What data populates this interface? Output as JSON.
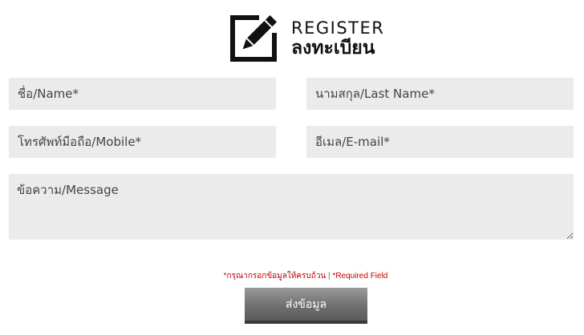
{
  "header": {
    "icon": "edit-pencil-icon",
    "title_en": "REGISTER",
    "title_th": "ลงทะเบียน"
  },
  "form": {
    "name_placeholder": "ชื่อ/Name*",
    "last_name_placeholder": "นามสกุล/Last Name*",
    "mobile_placeholder": "โทรศัพท์มือถือ/Mobile*",
    "email_placeholder": "อีเมล/E-mail*",
    "message_placeholder": "ข้อความ/Message",
    "required_note_th": "*กรุณากรอกข้อมูลให้ครบถ้วน",
    "required_note_sep": " | ",
    "required_note_en": "*Required Field",
    "submit_label": "ส่งข้อมูล"
  },
  "colors": {
    "field_bg": "#ebebeb",
    "required_text": "#c00000",
    "button_top": "#9a9a9a",
    "button_bottom": "#5a5a5a"
  }
}
